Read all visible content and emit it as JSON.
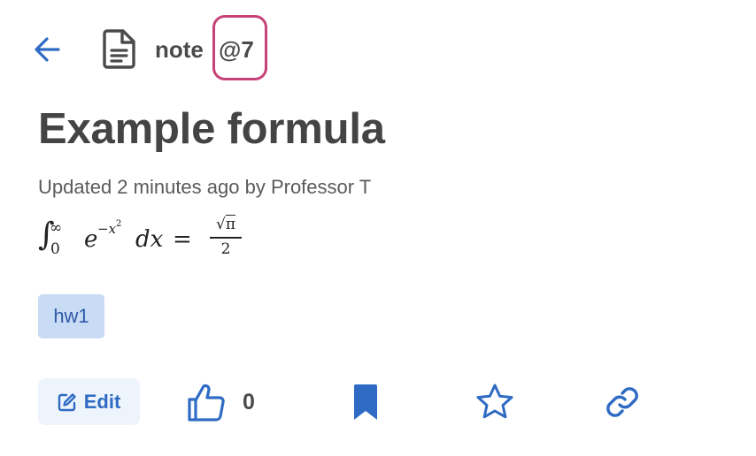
{
  "header": {
    "back_icon": "arrow-left-icon",
    "doc_icon": "document-icon",
    "note_label": "note",
    "note_number": "@7"
  },
  "post": {
    "title": "Example formula",
    "meta": "Updated 2 minutes ago by Professor T",
    "formula": {
      "integral": "∫",
      "upper_limit": "∞",
      "lower_limit": "0",
      "base": "e",
      "exponent": "−x",
      "exponent_power": "2",
      "differential": "dx",
      "equals": "=",
      "numerator": "√π",
      "numerator_radicand": "π",
      "numerator_root": "√",
      "denominator": "2"
    },
    "tags": [
      "hw1"
    ]
  },
  "actions": {
    "edit_label": "Edit",
    "like_count": "0",
    "icons": [
      "edit-icon",
      "thumbs-up-icon",
      "bookmark-icon",
      "star-icon",
      "link-icon"
    ]
  },
  "colors": {
    "accent": "#2f6bc4",
    "highlight": "#c8427a",
    "tag_bg": "#c9dcf6",
    "edit_bg": "#eef4fc",
    "text": "#444444"
  }
}
